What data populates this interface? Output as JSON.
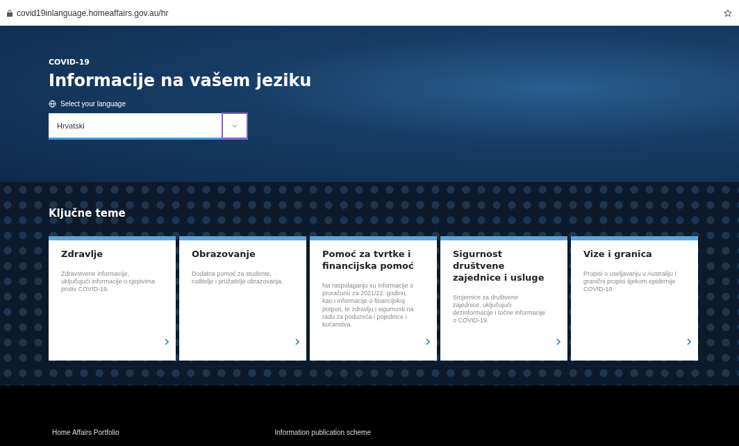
{
  "address_bar": {
    "url": "covid19inlanguage.homeaffairs.gov.au/hr"
  },
  "hero": {
    "eyebrow": "COVID-19",
    "title": "Informacije na vašem jeziku",
    "language_label": "Select your language",
    "language_select": {
      "value": "Hrvatski"
    }
  },
  "key_topics": {
    "heading": "Ključne teme",
    "cards": [
      {
        "title": "Zdravlje",
        "text": "Zdravstvene informacije, uključujući informacije o cjepivima protiv COVID-19."
      },
      {
        "title": "Obrazovanje",
        "text": "Dodatna pomoć za studente, roditelje i pružatelje obrazovanja."
      },
      {
        "title": "Pomoć za tvrtke i financijska pomoć",
        "text": "Na raspolaganju su informacije o proračunu za 2021/22. godinu, kao i informacije o financijskoj potpori, te zdravlju i sigurnosti na radu za poduzeća i pojedince i kućanstva."
      },
      {
        "title": "Sigurnost društvene zajednice i usluge",
        "text": "Smjernice za društvene zajednice, uključujući dezinformacije i točne informacije o COVID-19."
      },
      {
        "title": "Vize i granica",
        "text": "Propisi o useljavanju u Australiju i granični propisi tijekom epidemije COVID-19."
      }
    ]
  },
  "footer": {
    "links": [
      "Home Affairs Portfolio",
      "Information publication scheme"
    ]
  }
}
